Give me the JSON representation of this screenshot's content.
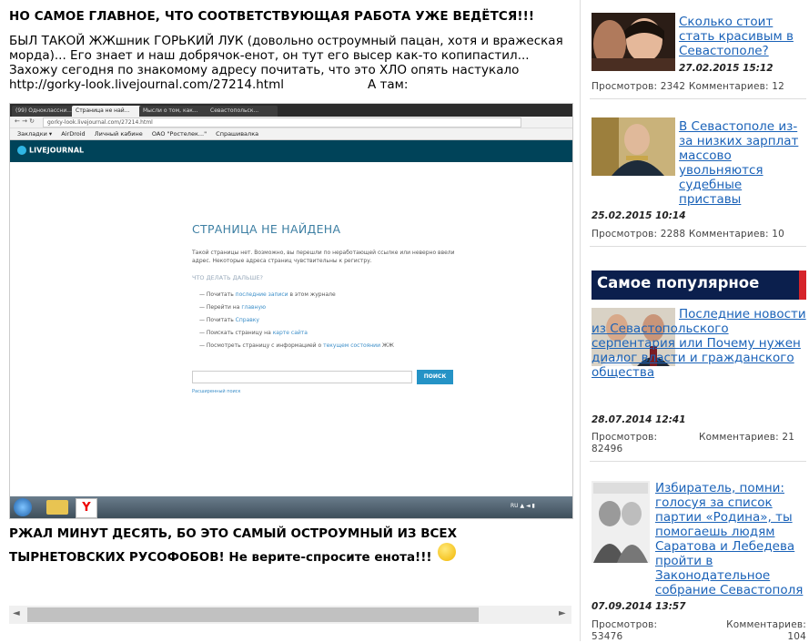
{
  "post": {
    "heading": "НО САМОЕ ГЛАВНОЕ, ЧТО СООТВЕТСТВУЮЩАЯ РАБОТА УЖЕ ВЕДЁТСЯ!!!",
    "intro": "БЫЛ ТАКОЙ ЖЖшник ГОРЬКИЙ ЛУК (довольно остроумный пацан, хотя и вражеская морда)... Его знает и наш добрячок-енот, он тут его высер как-то копипастил... Захожу сегодня по знакомому адресу почитать, что это ХЛО опять настукало http://gorky-look.livejournal.com/27214.html",
    "intro_tail": "А там:",
    "conclusion_line1": "РЖАЛ МИНУТ ДЕСЯТЬ, БО ЭТО САМЫЙ ОСТРОУМНЫЙ ИЗ ВСЕХ",
    "conclusion_line2": "ТЫРНЕТОВСКИХ РУСОФОБОВ! Не верите-спросите енота!!!"
  },
  "screenshot": {
    "tabs": [
      "(99) Одноклассни...",
      "Страница не най...",
      "Мысли о том, как...",
      "Севастопольск..."
    ],
    "address": "gorky-look.livejournal.com/27214.html",
    "bookmarks": [
      "Закладки ▾",
      "AirDroid",
      "Личный кабине",
      "ОАО \"Ростелек...\"",
      "Спрашивалка"
    ],
    "logo": "LIVEJOURNAL",
    "not_found_title": "СТРАНИЦА НЕ НАЙДЕНА",
    "not_found_desc": "Такой страницы нет. Возможно, вы перешли по неработающей ссылке или неверно ввели адрес. Некоторые адреса страниц чувствительны к регистру.",
    "what_next": "ЧТО ДЕЛАТЬ ДАЛЬШЕ?",
    "actions": [
      {
        "pre": "— Почитать ",
        "link": "последние записи",
        "post": " в этом журнале"
      },
      {
        "pre": "— Перейти на ",
        "link": "главную",
        "post": ""
      },
      {
        "pre": "— Почитать ",
        "link": "Справку",
        "post": ""
      },
      {
        "pre": "— Поискать страницу на ",
        "link": "карте сайта",
        "post": ""
      },
      {
        "pre": "— Посмотреть страницу с информацией о ",
        "link": "текущем состоянии",
        "post": " ЖЖ"
      }
    ],
    "search_button": "ПОИСК",
    "advanced_search": "Расширенный поиск",
    "tray": "RU ▲ ◄ ▮"
  },
  "sidebar": {
    "news": [
      {
        "title": "Сколько стоит стать красивым в Севастополе?",
        "date": "27.02.2015 15:12",
        "views_label": "Просмотров:",
        "views": "2342",
        "comments_label": "Комментариев:",
        "comments": "12"
      },
      {
        "title": "В Севастополе из-за низких зарплат массово увольняются судебные приставы",
        "date": "25.02.2015 10:14",
        "views_label": "Просмотров:",
        "views": "2288",
        "comments_label": "Комментариев:",
        "comments": "10"
      }
    ],
    "popular_heading": "Самое популярное",
    "popular": [
      {
        "title": "Последние новости из Севастопольского серпентария или Почему нужен диалог власти и гражданского общества",
        "date": "28.07.2014 12:41",
        "views_label": "Просмотров:",
        "views": "82496",
        "comments_label": "Комментариев:",
        "comments": "21"
      },
      {
        "title": "Избиратель, помни: голосуя за список партии «Родина», ты помогаешь людям Саратова и Лебедева пройти в Законодательное собрание Севастополя",
        "date": "07.09.2014 13:57",
        "views_label": "Просмотров:",
        "views": "53476",
        "comments_label": "Комментариев:",
        "comments": "104"
      }
    ]
  },
  "scrollbar": {
    "left_arrow": "◄",
    "right_arrow": "►"
  },
  "colors": {
    "link": "#1a62b8",
    "banner": "#0b1f4d",
    "banner_accent": "#d6232a",
    "lj_header": "#004359"
  }
}
